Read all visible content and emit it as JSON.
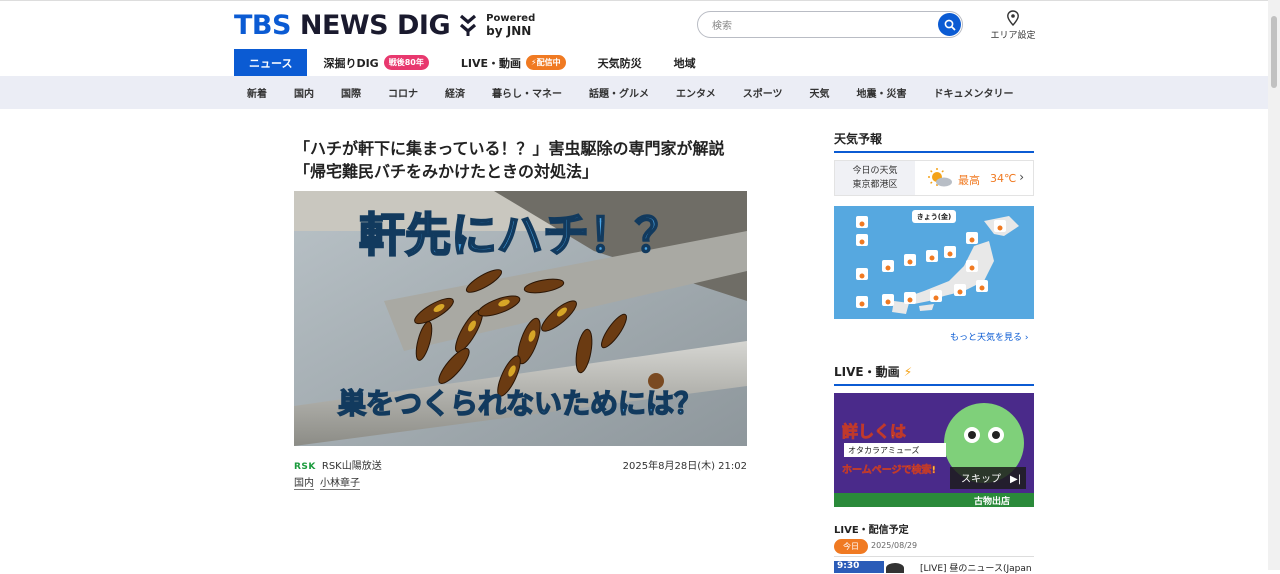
{
  "header": {
    "logo_prefix": "TBS",
    "logo_main": " NEWS DIG",
    "powered_by": "Powered",
    "powered_jnn": "by JNN",
    "search_placeholder": "検索",
    "area_label": "エリア設定"
  },
  "nav": [
    {
      "label": "ニュース",
      "active": true
    },
    {
      "label": "深掘りDIG",
      "badge": "戦後80年"
    },
    {
      "label": "LIVE・動画",
      "badge": "配信中"
    },
    {
      "label": "天気防災"
    },
    {
      "label": "地域"
    }
  ],
  "subnav": [
    "新着",
    "国内",
    "国際",
    "コロナ",
    "経済",
    "暮らし・マネー",
    "話題・グルメ",
    "エンタメ",
    "スポーツ",
    "天気",
    "地震・災害",
    "ドキュメンタリー"
  ],
  "article": {
    "headline_line1": "「ハチが軒下に集まっている！？」害虫駆除の専門家が解説",
    "headline_line2": "「帰宅難民バチをみかけたときの対処法」",
    "image_text_top": "軒先にハチ！？",
    "image_text_bottom": "巣をつくられないためには？",
    "source_logo": "RSK",
    "source_name": "RSK山陽放送",
    "date": "2025年8月28日(木) 21:02",
    "tags": [
      "国内",
      "小林章子"
    ]
  },
  "sidebar": {
    "weather_title": "天気予報",
    "weather_today": "今日の天気",
    "weather_place": "東京都港区",
    "weather_high_label": "最高",
    "weather_high_temp": "34℃",
    "map_day": "きょう(金)",
    "more_weather": "もっと天気を見る",
    "live_title": "LIVE・動画",
    "live_thumb_text1": "詳しくは",
    "live_thumb_search": "オタカラアミューズ",
    "live_thumb_text2": "ホームページで検索!",
    "live_thumb_skip": "スキップ",
    "live_thumb_text3": "古物出店",
    "schedule_title": "LIVE・配信予定",
    "schedule_today": "今日",
    "schedule_date": "2025/08/29",
    "schedule_item_time": "9:30",
    "schedule_item": "[LIVE] 昼のニュース(Japan"
  },
  "colors": {
    "brand": "#0b5bd3",
    "accent_orange": "#f07a22",
    "badge_red": "#e8386e"
  }
}
